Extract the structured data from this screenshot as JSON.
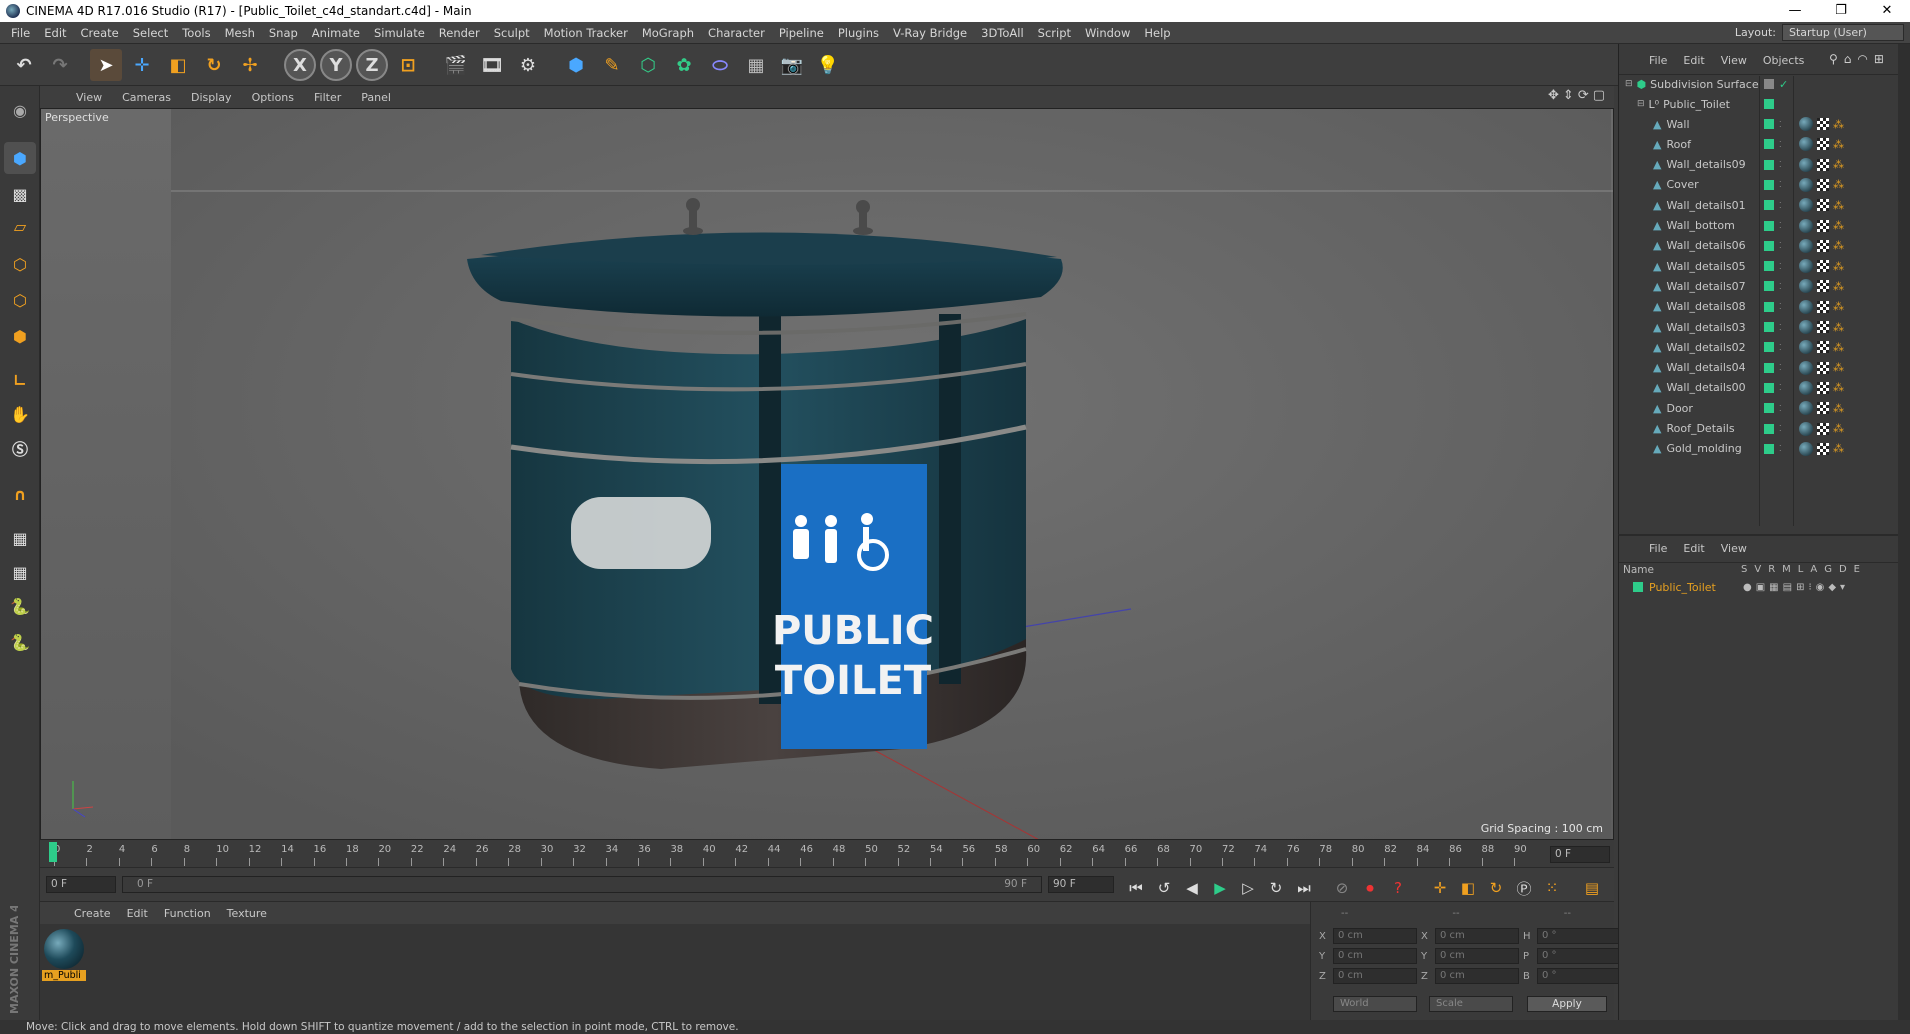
{
  "window": {
    "title": "CINEMA 4D R17.016 Studio (R17) - [Public_Toilet_c4d_standart.c4d] - Main",
    "controls": [
      "—",
      "❐",
      "✕"
    ]
  },
  "menubar": {
    "items": [
      "File",
      "Edit",
      "Create",
      "Select",
      "Tools",
      "Mesh",
      "Snap",
      "Animate",
      "Simulate",
      "Render",
      "Sculpt",
      "Motion Tracker",
      "MoGraph",
      "Character",
      "Pipeline",
      "Plugins",
      "V-Ray Bridge",
      "3DToAll",
      "Script",
      "Window",
      "Help"
    ],
    "layout_label": "Layout:",
    "layout_value": "Startup (User)"
  },
  "viewport": {
    "menu": [
      "View",
      "Cameras",
      "Display",
      "Options",
      "Filter",
      "Panel"
    ],
    "camera_label": "Perspective",
    "grid_spacing": "Grid Spacing : 100 cm",
    "sign_line1": "PUBLIC",
    "sign_line2": "TOILET"
  },
  "timeline": {
    "ticks": [
      "0",
      "2",
      "4",
      "6",
      "8",
      "10",
      "12",
      "14",
      "16",
      "18",
      "20",
      "22",
      "24",
      "26",
      "28",
      "30",
      "32",
      "34",
      "36",
      "38",
      "40",
      "42",
      "44",
      "46",
      "48",
      "50",
      "52",
      "54",
      "56",
      "58",
      "60",
      "62",
      "64",
      "66",
      "68",
      "70",
      "72",
      "74",
      "76",
      "78",
      "80",
      "82",
      "84",
      "86",
      "88",
      "90"
    ],
    "current_frame": "0 F",
    "start_field": "0 F",
    "range_start": "0 F",
    "range_end": "90 F",
    "end_field": "90 F"
  },
  "materials": {
    "menu": [
      "Create",
      "Edit",
      "Function",
      "Texture"
    ],
    "items": [
      {
        "name": "m_Publi"
      }
    ]
  },
  "coordinates": {
    "header": [
      "--",
      "--",
      "--"
    ],
    "rows": [
      {
        "a": "X",
        "av": "0 cm",
        "b": "X",
        "bv": "0 cm",
        "c": "H",
        "cv": "0 °"
      },
      {
        "a": "Y",
        "av": "0 cm",
        "b": "Y",
        "bv": "0 cm",
        "c": "P",
        "cv": "0 °"
      },
      {
        "a": "Z",
        "av": "0 cm",
        "b": "Z",
        "bv": "0 cm",
        "c": "B",
        "cv": "0 °"
      }
    ],
    "space": "World",
    "mode": "Scale",
    "apply": "Apply"
  },
  "objects": {
    "menu": [
      "File",
      "Edit",
      "View",
      "Objects"
    ],
    "root": "Subdivision Surface",
    "group": "Public_Toilet",
    "children": [
      "Wall",
      "Roof",
      "Wall_details09",
      "Cover",
      "Wall_details01",
      "Wall_bottom",
      "Wall_details06",
      "Wall_details05",
      "Wall_details07",
      "Wall_details08",
      "Wall_details03",
      "Wall_details02",
      "Wall_details04",
      "Wall_details00",
      "Door",
      "Roof_Details",
      "Gold_molding"
    ]
  },
  "attributes": {
    "menu": [
      "File",
      "Edit",
      "View"
    ],
    "col_name": "Name",
    "cols": [
      "S",
      "V",
      "R",
      "M",
      "L",
      "A",
      "G",
      "D",
      "E"
    ],
    "layer": "Public_Toilet"
  },
  "status": "Move: Click and drag to move elements. Hold down SHIFT to quantize movement / add to the selection in point mode, CTRL to remove.",
  "brand": "MAXON CINEMA 4D",
  "colors": {
    "accent_green": "#2ecc8a",
    "layer_orange": "#e6a020",
    "sign_blue": "#1a6fc4",
    "toilet_teal": "#1e4a5a"
  }
}
